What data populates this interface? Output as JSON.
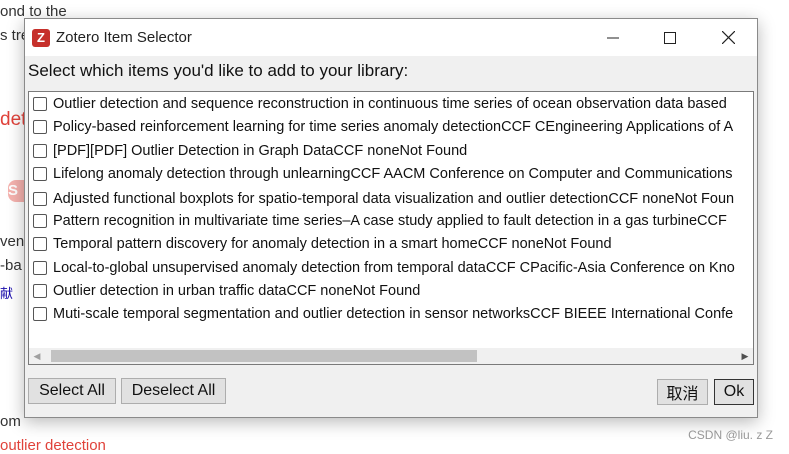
{
  "background": {
    "fragments": [
      "ond to the",
      "s tre",
      "det",
      "S",
      "ven",
      "-ba",
      "献",
      "om",
      "outlier detection"
    ],
    "watermark": "CSDN @liu. z Z"
  },
  "dialog": {
    "title": "Zotero Item Selector",
    "app_icon": "Z",
    "prompt": "Select which items you'd like to add to your library:",
    "items": [
      {
        "checked": false,
        "label": "Outlier detection and sequence reconstruction in continuous time series of ocean observation data based"
      },
      {
        "checked": false,
        "label": "Policy-based reinforcement learning for time series anomaly detectionCCF CEngineering Applications of A"
      },
      {
        "checked": false,
        "label": "[PDF][PDF] Outlier Detection in Graph DataCCF noneNot Found"
      },
      {
        "checked": false,
        "label": "Lifelong anomaly detection through unlearningCCF AACM Conference on Computer and Communications"
      },
      {
        "checked": false,
        "label": "Adjusted functional boxplots for spatio-temporal data visualization and outlier detectionCCF noneNot Foun"
      },
      {
        "checked": false,
        "label": "Pattern recognition in multivariate time series–A case study applied to fault detection in a gas turbineCCF"
      },
      {
        "checked": false,
        "label": "Temporal pattern discovery for anomaly detection in a smart homeCCF noneNot Found"
      },
      {
        "checked": false,
        "label": "Local-to-global unsupervised anomaly detection from temporal dataCCF CPacific-Asia Conference on Kno"
      },
      {
        "checked": false,
        "label": "Outlier detection in urban traffic dataCCF noneNot Found"
      },
      {
        "checked": false,
        "label": "Muti-scale temporal segmentation and outlier detection in sensor networksCCF BIEEE International Confe"
      }
    ],
    "scrollbar": {
      "horizontal_position": 0.0
    },
    "buttons": {
      "select_all": "Select All",
      "deselect_all": "Deselect All",
      "cancel": "取消",
      "ok": "Ok"
    },
    "window_controls": [
      "minimize-icon",
      "maximize-icon",
      "close-icon"
    ]
  }
}
